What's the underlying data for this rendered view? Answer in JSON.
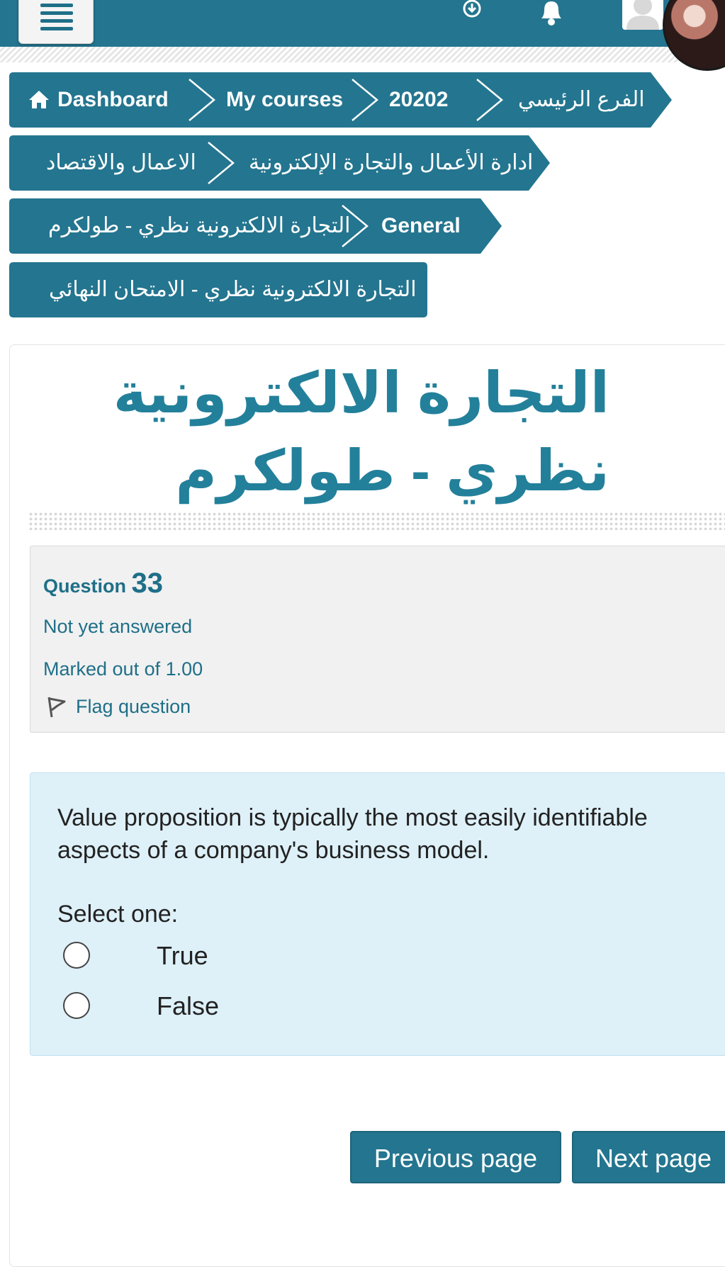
{
  "navbar": {
    "menu_icon": "hamburger-menu-icon",
    "download_icon": "download-circle-icon",
    "notification_icon": "bell-icon",
    "user_icon": "user-avatar-icon",
    "brand_color": "#24758f"
  },
  "breadcrumb": {
    "dashboard": "Dashboard",
    "my_courses": "My courses",
    "term": "20202",
    "branch": "الفرع الرئيسي",
    "faculty": "الاعمال والاقتصاد",
    "department": "ادارة الأعمال والتجارة الإلكترونية",
    "course": "التجارة الالكترونية نظري - طولكرم",
    "section": "General",
    "quiz": "التجارة الالكترونية نظري - الامتحان النهائي"
  },
  "page": {
    "title": "التجارة الالكترونية نظري - طولكرم"
  },
  "question_info": {
    "label": "Question",
    "number": "33",
    "status": "Not yet answered",
    "marks": "Marked out of 1.00",
    "flag": "Flag question"
  },
  "question": {
    "text": "Value proposition is typically the most easily identifiable aspects of a company's business model.",
    "prompt": "Select one:",
    "options": [
      "True",
      "False"
    ]
  },
  "navigation": {
    "previous": "Previous page",
    "next": "Next page"
  }
}
